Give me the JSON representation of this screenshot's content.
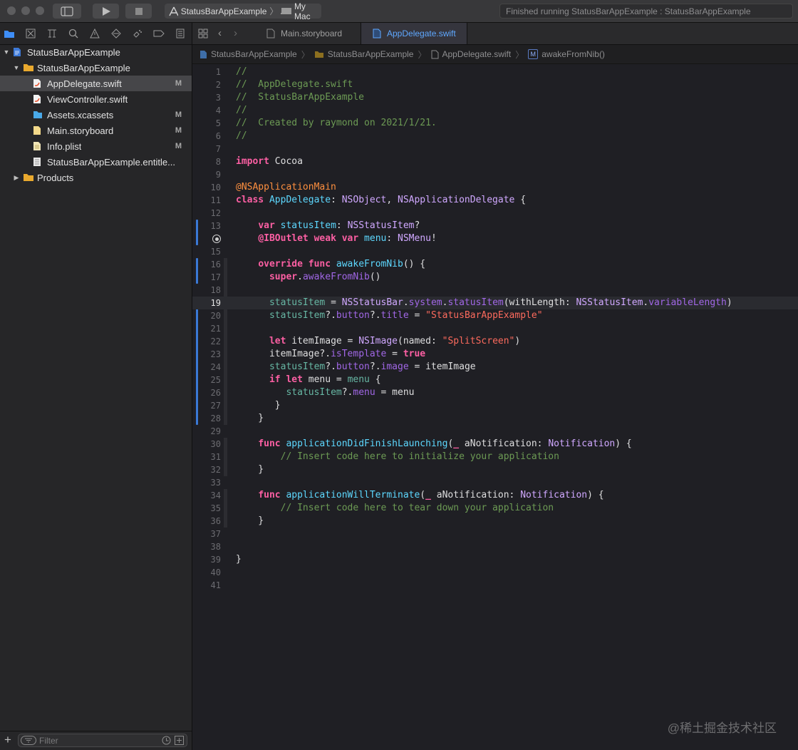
{
  "toolbar": {
    "scheme_target": "StatusBarAppExample",
    "scheme_device": "My Mac",
    "activity_text": "Finished running StatusBarAppExample : StatusBarAppExample"
  },
  "navigator": {
    "tree": [
      {
        "label": "StatusBarAppExample",
        "kind": "project",
        "badge": ""
      },
      {
        "label": "StatusBarAppExample",
        "kind": "folder",
        "badge": ""
      },
      {
        "label": "AppDelegate.swift",
        "kind": "swift",
        "badge": "M",
        "selected": true
      },
      {
        "label": "ViewController.swift",
        "kind": "swift",
        "badge": ""
      },
      {
        "label": "Assets.xcassets",
        "kind": "assets",
        "badge": "M"
      },
      {
        "label": "Main.storyboard",
        "kind": "storyboard",
        "badge": "M"
      },
      {
        "label": "Info.plist",
        "kind": "plist",
        "badge": "M"
      },
      {
        "label": "StatusBarAppExample.entitle...",
        "kind": "entitlements",
        "badge": ""
      },
      {
        "label": "Products",
        "kind": "folder",
        "badge": ""
      }
    ],
    "filter_placeholder": "Filter"
  },
  "editor": {
    "tabs": [
      {
        "label": "Main.storyboard",
        "active": false
      },
      {
        "label": "AppDelegate.swift",
        "active": true
      }
    ],
    "jumpbar": [
      "StatusBarAppExample",
      "StatusBarAppExample",
      "AppDelegate.swift",
      "awakeFromNib()"
    ],
    "current_line": 19,
    "lines": [
      [
        [
          "c",
          "//"
        ]
      ],
      [
        [
          "c",
          "//  AppDelegate.swift"
        ]
      ],
      [
        [
          "c",
          "//  StatusBarAppExample"
        ]
      ],
      [
        [
          "c",
          "//"
        ]
      ],
      [
        [
          "c",
          "//  Created by raymond on 2021/1/21."
        ]
      ],
      [
        [
          "c",
          "//"
        ]
      ],
      [],
      [
        [
          "k",
          "import"
        ],
        [
          "p",
          " Cocoa"
        ]
      ],
      [],
      [
        [
          "a",
          "@NSApplicationMain"
        ]
      ],
      [
        [
          "k",
          "class"
        ],
        [
          "p",
          " "
        ],
        [
          "cl",
          "AppDelegate"
        ],
        [
          "p",
          ": "
        ],
        [
          "t",
          "NSObject"
        ],
        [
          "p",
          ", "
        ],
        [
          "t",
          "NSApplicationDelegate"
        ],
        [
          "p",
          " {"
        ]
      ],
      [],
      [
        [
          "p",
          "    "
        ],
        [
          "k",
          "var"
        ],
        [
          "p",
          " "
        ],
        [
          "cl",
          "statusItem"
        ],
        [
          "p",
          ": "
        ],
        [
          "t",
          "NSStatusItem"
        ],
        [
          "p",
          "?"
        ]
      ],
      [
        [
          "p",
          "    "
        ],
        [
          "k",
          "@IBOutlet"
        ],
        [
          "p",
          " "
        ],
        [
          "k",
          "weak"
        ],
        [
          "p",
          " "
        ],
        [
          "k",
          "var"
        ],
        [
          "p",
          " "
        ],
        [
          "cl",
          "menu"
        ],
        [
          "p",
          ": "
        ],
        [
          "t",
          "NSMenu"
        ],
        [
          "p",
          "!"
        ]
      ],
      [],
      [
        [
          "p",
          "    "
        ],
        [
          "k",
          "override"
        ],
        [
          "p",
          " "
        ],
        [
          "k",
          "func"
        ],
        [
          "p",
          " "
        ],
        [
          "cl",
          "awakeFromNib"
        ],
        [
          "p",
          "() {"
        ]
      ],
      [
        [
          "p",
          "      "
        ],
        [
          "k",
          "super"
        ],
        [
          "p",
          "."
        ],
        [
          "pr",
          "awakeFromNib"
        ],
        [
          "p",
          "()"
        ]
      ],
      [],
      [
        [
          "p",
          "      "
        ],
        [
          "f",
          "statusItem"
        ],
        [
          "p",
          " = "
        ],
        [
          "t",
          "NSStatusBar"
        ],
        [
          "p",
          "."
        ],
        [
          "pr",
          "system"
        ],
        [
          "p",
          "."
        ],
        [
          "pr",
          "statusItem"
        ],
        [
          "p",
          "(withLength: "
        ],
        [
          "t",
          "NSStatusItem"
        ],
        [
          "p",
          "."
        ],
        [
          "pr",
          "variableLength"
        ],
        [
          "p",
          ")"
        ]
      ],
      [
        [
          "p",
          "      "
        ],
        [
          "f",
          "statusItem"
        ],
        [
          "p",
          "?."
        ],
        [
          "pr",
          "button"
        ],
        [
          "p",
          "?."
        ],
        [
          "pr",
          "title"
        ],
        [
          "p",
          " = "
        ],
        [
          "s",
          "\"StatusBarAppExample\""
        ]
      ],
      [],
      [
        [
          "p",
          "      "
        ],
        [
          "k",
          "let"
        ],
        [
          "p",
          " itemImage = "
        ],
        [
          "t",
          "NSImage"
        ],
        [
          "p",
          "(named: "
        ],
        [
          "s",
          "\"SplitScreen\""
        ],
        [
          "p",
          ")"
        ]
      ],
      [
        [
          "p",
          "      itemImage?."
        ],
        [
          "pr",
          "isTemplate"
        ],
        [
          "p",
          " = "
        ],
        [
          "k",
          "true"
        ]
      ],
      [
        [
          "p",
          "      "
        ],
        [
          "f",
          "statusItem"
        ],
        [
          "p",
          "?."
        ],
        [
          "pr",
          "button"
        ],
        [
          "p",
          "?."
        ],
        [
          "pr",
          "image"
        ],
        [
          "p",
          " = itemImage"
        ]
      ],
      [
        [
          "p",
          "      "
        ],
        [
          "k",
          "if"
        ],
        [
          "p",
          " "
        ],
        [
          "k",
          "let"
        ],
        [
          "p",
          " menu = "
        ],
        [
          "f",
          "menu"
        ],
        [
          "p",
          " {"
        ]
      ],
      [
        [
          "p",
          "         "
        ],
        [
          "f",
          "statusItem"
        ],
        [
          "p",
          "?."
        ],
        [
          "pr",
          "menu"
        ],
        [
          "p",
          " = menu"
        ]
      ],
      [
        [
          "p",
          "       }"
        ]
      ],
      [
        [
          "p",
          "    }"
        ]
      ],
      [],
      [
        [
          "p",
          "    "
        ],
        [
          "k",
          "func"
        ],
        [
          "p",
          " "
        ],
        [
          "cl",
          "applicationDidFinishLaunching"
        ],
        [
          "p",
          "("
        ],
        [
          "k",
          "_"
        ],
        [
          "p",
          " aNotification: "
        ],
        [
          "t",
          "Notification"
        ],
        [
          "p",
          ") {"
        ]
      ],
      [
        [
          "p",
          "        "
        ],
        [
          "c",
          "// Insert code here to initialize your application"
        ]
      ],
      [
        [
          "p",
          "    }"
        ]
      ],
      [],
      [
        [
          "p",
          "    "
        ],
        [
          "k",
          "func"
        ],
        [
          "p",
          " "
        ],
        [
          "cl",
          "applicationWillTerminate"
        ],
        [
          "p",
          "("
        ],
        [
          "k",
          "_"
        ],
        [
          "p",
          " aNotification: "
        ],
        [
          "t",
          "Notification"
        ],
        [
          "p",
          ") {"
        ]
      ],
      [
        [
          "p",
          "        "
        ],
        [
          "c",
          "// Insert code here to tear down your application"
        ]
      ],
      [
        [
          "p",
          "    }"
        ]
      ],
      [],
      [],
      [
        [
          "p",
          "}"
        ]
      ],
      [],
      []
    ]
  },
  "watermark": "@稀土掘金技术社区"
}
